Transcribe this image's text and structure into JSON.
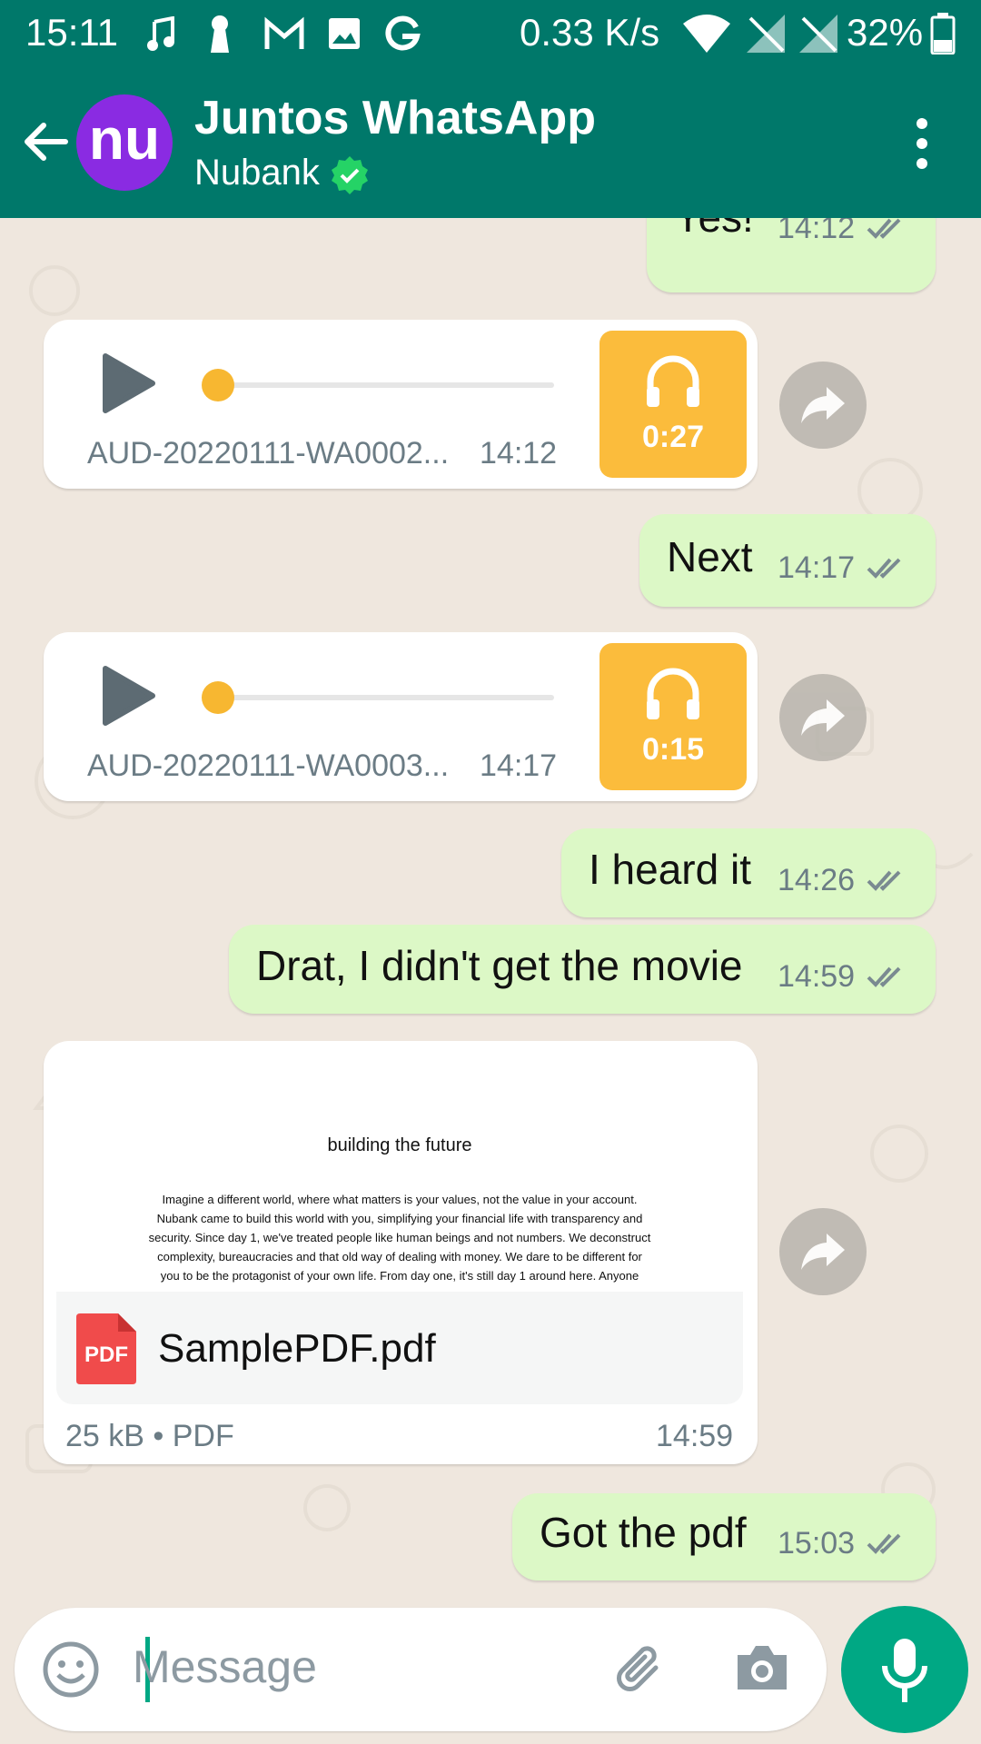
{
  "status_bar": {
    "time": "15:11",
    "net_speed": "0.33 K/s",
    "battery": "32%",
    "icons": [
      "music-note-icon",
      "keyhole-icon",
      "gmail-icon",
      "image-icon",
      "google-icon",
      "wifi-icon",
      "no-signal-icon",
      "no-signal-icon",
      "battery-icon"
    ]
  },
  "header": {
    "title": "Juntos WhatsApp",
    "subtitle": "Nubank",
    "avatar_text": "nu",
    "colors": {
      "header": "#00786a",
      "avatar": "#8a2be2",
      "verified": "#25d366"
    }
  },
  "messages": [
    {
      "type": "text",
      "direction": "out",
      "text": "Yes!",
      "time": "14:12"
    },
    {
      "type": "audio",
      "direction": "in",
      "filename": "AUD-20220111-WA0002...",
      "time": "14:12",
      "duration": "0:27",
      "progress": 0
    },
    {
      "type": "text",
      "direction": "out",
      "text": "Next",
      "time": "14:17"
    },
    {
      "type": "audio",
      "direction": "in",
      "filename": "AUD-20220111-WA0003...",
      "time": "14:17",
      "duration": "0:15",
      "progress": 0
    },
    {
      "type": "text",
      "direction": "out",
      "text": "I heard it",
      "time": "14:26"
    },
    {
      "type": "text",
      "direction": "out",
      "text": "Drat, I didn't get the movie",
      "time": "14:59"
    },
    {
      "type": "document",
      "direction": "in",
      "preview_title": "building the future",
      "preview_lines": [
        "Imagine a different world, where what matters is your values, not the value in your account.",
        "Nubank came to build this world with you, simplifying your financial life with transparency and",
        "security. Since day 1, we've treated people like human beings and not numbers. We deconstruct",
        "complexity, bureaucracies and that old way of dealing with money. We dare to be different for",
        "you to be the protagonist of your own life. From day one, it's still day 1 around here. Anyone"
      ],
      "file_icon_label": "PDF",
      "filename": "SamplePDF.pdf",
      "meta": "25 kB • PDF",
      "time": "14:59"
    },
    {
      "type": "text",
      "direction": "out",
      "text": "Got the pdf",
      "time": "15:03"
    }
  ],
  "composer": {
    "placeholder": "Message"
  }
}
